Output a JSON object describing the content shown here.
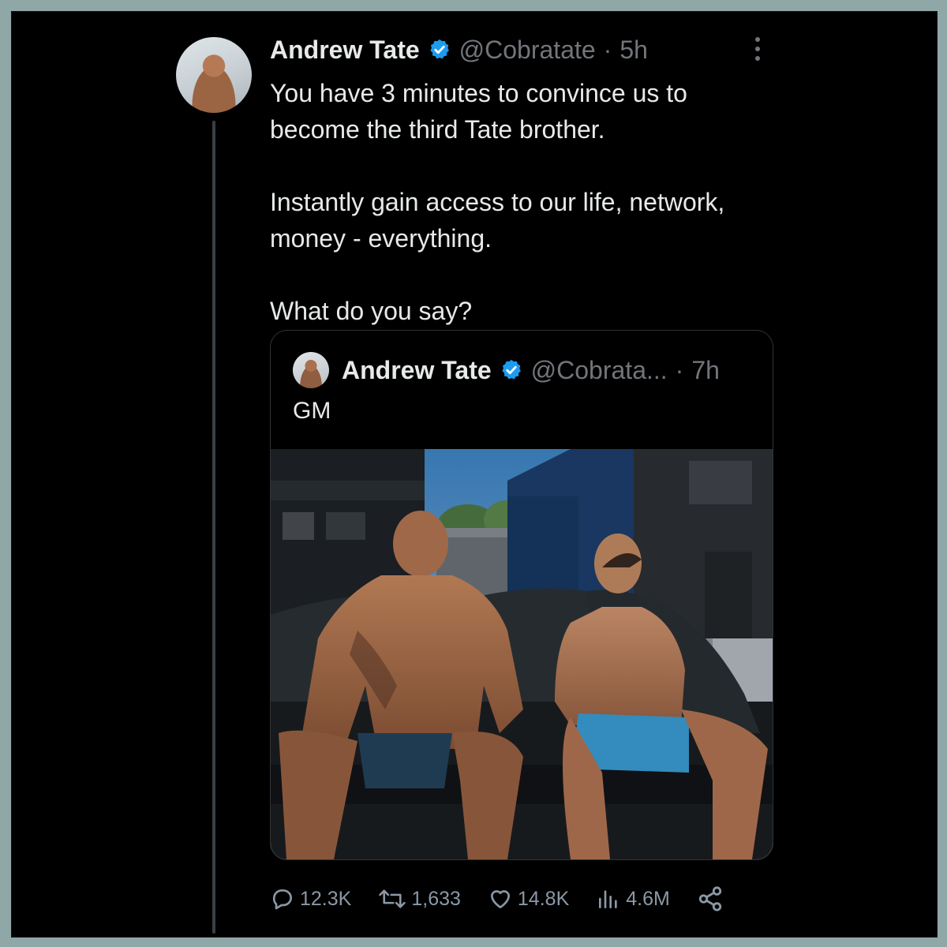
{
  "tweet": {
    "author_name": "Andrew Tate",
    "handle": "@Cobratate",
    "separator": "·",
    "time": "5h",
    "paragraphs": [
      "You have 3 minutes to convince us to become the third Tate brother.",
      "Instantly gain access to our life, network, money - everything.",
      "What do you say?"
    ]
  },
  "quoted": {
    "author_name": "Andrew Tate",
    "handle": "@Cobrata...",
    "separator": "·",
    "time": "7h",
    "text": "GM"
  },
  "actions": {
    "replies": "12.3K",
    "reposts": "1,633",
    "likes": "14.8K",
    "views": "4.6M"
  },
  "icons": {
    "verified": "verified-badge-icon",
    "more": "more-icon",
    "reply": "reply-icon",
    "repost": "repost-icon",
    "like": "heart-icon",
    "views": "views-icon",
    "share": "share-icon"
  },
  "colors": {
    "background": "#000000",
    "outer_border": "#8fa7a6",
    "text": "#e7e9ea",
    "muted": "#71767b",
    "verified": "#1d9bf0"
  }
}
